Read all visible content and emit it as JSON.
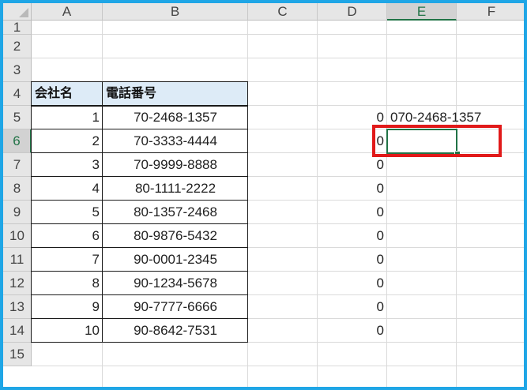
{
  "sheet": {
    "columns": [
      "A",
      "B",
      "C",
      "D",
      "E",
      "F"
    ],
    "rows": [
      "1",
      "2",
      "3",
      "4",
      "5",
      "6",
      "7",
      "8",
      "9",
      "10",
      "11",
      "12",
      "13",
      "14",
      "15"
    ],
    "selected_column": "E",
    "selected_row": "6"
  },
  "table": {
    "header": {
      "company": "会社名",
      "phone": "電話番号"
    },
    "numbers": [
      "1",
      "2",
      "3",
      "4",
      "5",
      "6",
      "7",
      "8",
      "9",
      "10"
    ],
    "phones": [
      "70-2468-1357",
      "70-3333-4444",
      "70-9999-8888",
      "80-1111-2222",
      "80-1357-2468",
      "80-9876-5432",
      "90-0001-2345",
      "90-1234-5678",
      "90-7777-6666",
      "90-8642-7531"
    ]
  },
  "column_d_values": [
    "0",
    "0",
    "0",
    "0",
    "0",
    "0",
    "0",
    "0",
    "0",
    "0"
  ],
  "e5_value": "070-2468-1357",
  "colors": {
    "frame": "#1fa6e6",
    "highlight": "#e11a1a",
    "selection": "#217346",
    "table_header_fill": "#ddebf7"
  }
}
